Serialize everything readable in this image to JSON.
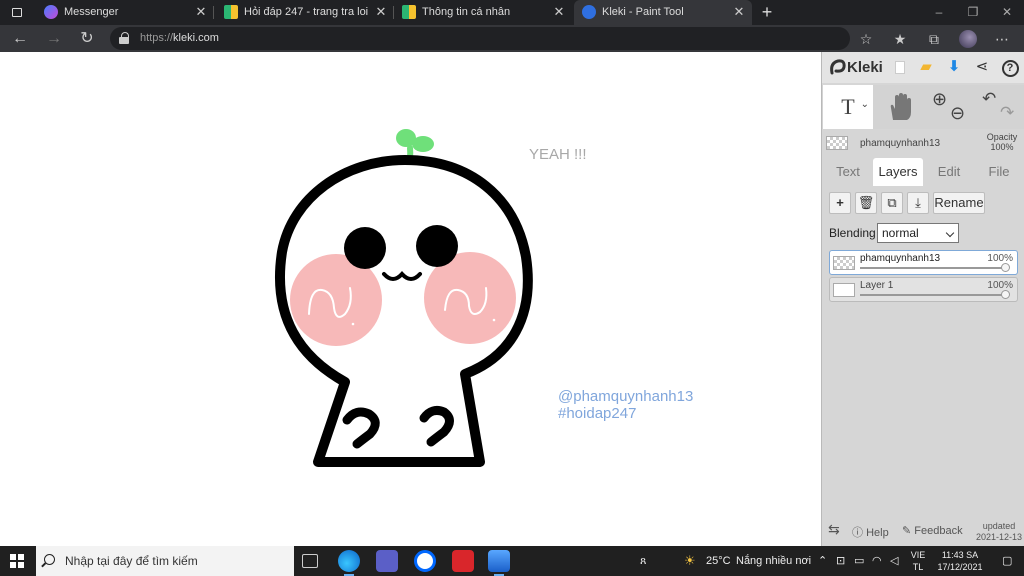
{
  "browser": {
    "tabs": [
      {
        "title": "Messenger",
        "active": false
      },
      {
        "title": "Hỏi đáp 247 - trang tra loi",
        "active": false
      },
      {
        "title": "Thông tin cá nhân",
        "active": false
      },
      {
        "title": "Kleki - Paint Tool",
        "active": true
      }
    ],
    "url_prefix": "https://",
    "url_host": "kleki.com"
  },
  "canvas": {
    "text_yeah": "YEAH !!!",
    "credit_line1": "@phamquynhanh13",
    "credit_line2": "#hoidap247"
  },
  "kleki": {
    "app_name": "Kleki",
    "tool_text_glyph": "T",
    "current_layer": {
      "name": "phamquynhanh13",
      "opacity_label": "Opacity",
      "opacity_value": "100%"
    },
    "panel_tabs": [
      "Text",
      "Layers",
      "Edit",
      "File"
    ],
    "active_tab": "Layers",
    "rename_label": "Rename",
    "blending_label": "Blending",
    "blending_value": "normal",
    "layers": [
      {
        "name": "phamquynhanh13",
        "opacity": "100%",
        "selected": true
      },
      {
        "name": "Layer 1",
        "opacity": "100%",
        "selected": false
      }
    ],
    "help_label": "Help",
    "feedback_label": "Feedback",
    "updated_label": "updated",
    "updated_date": "2021-12-13"
  },
  "taskbar": {
    "search_placeholder": "Nhập tại đây để tìm kiếm",
    "weather_temp": "25°C",
    "weather_text": "Nắng nhiều nơi",
    "lang_line1": "VIE",
    "lang_line2": "TL",
    "time": "11:43 SA",
    "date": "17/12/2021"
  },
  "colors": {
    "outline": "#000000",
    "blush": "#f7b9b9",
    "sprout": "#6fe07a",
    "credit_text": "#80a6dc",
    "yeah_text": "#a8a8a8",
    "kleki_accent": "#1e88e5"
  }
}
